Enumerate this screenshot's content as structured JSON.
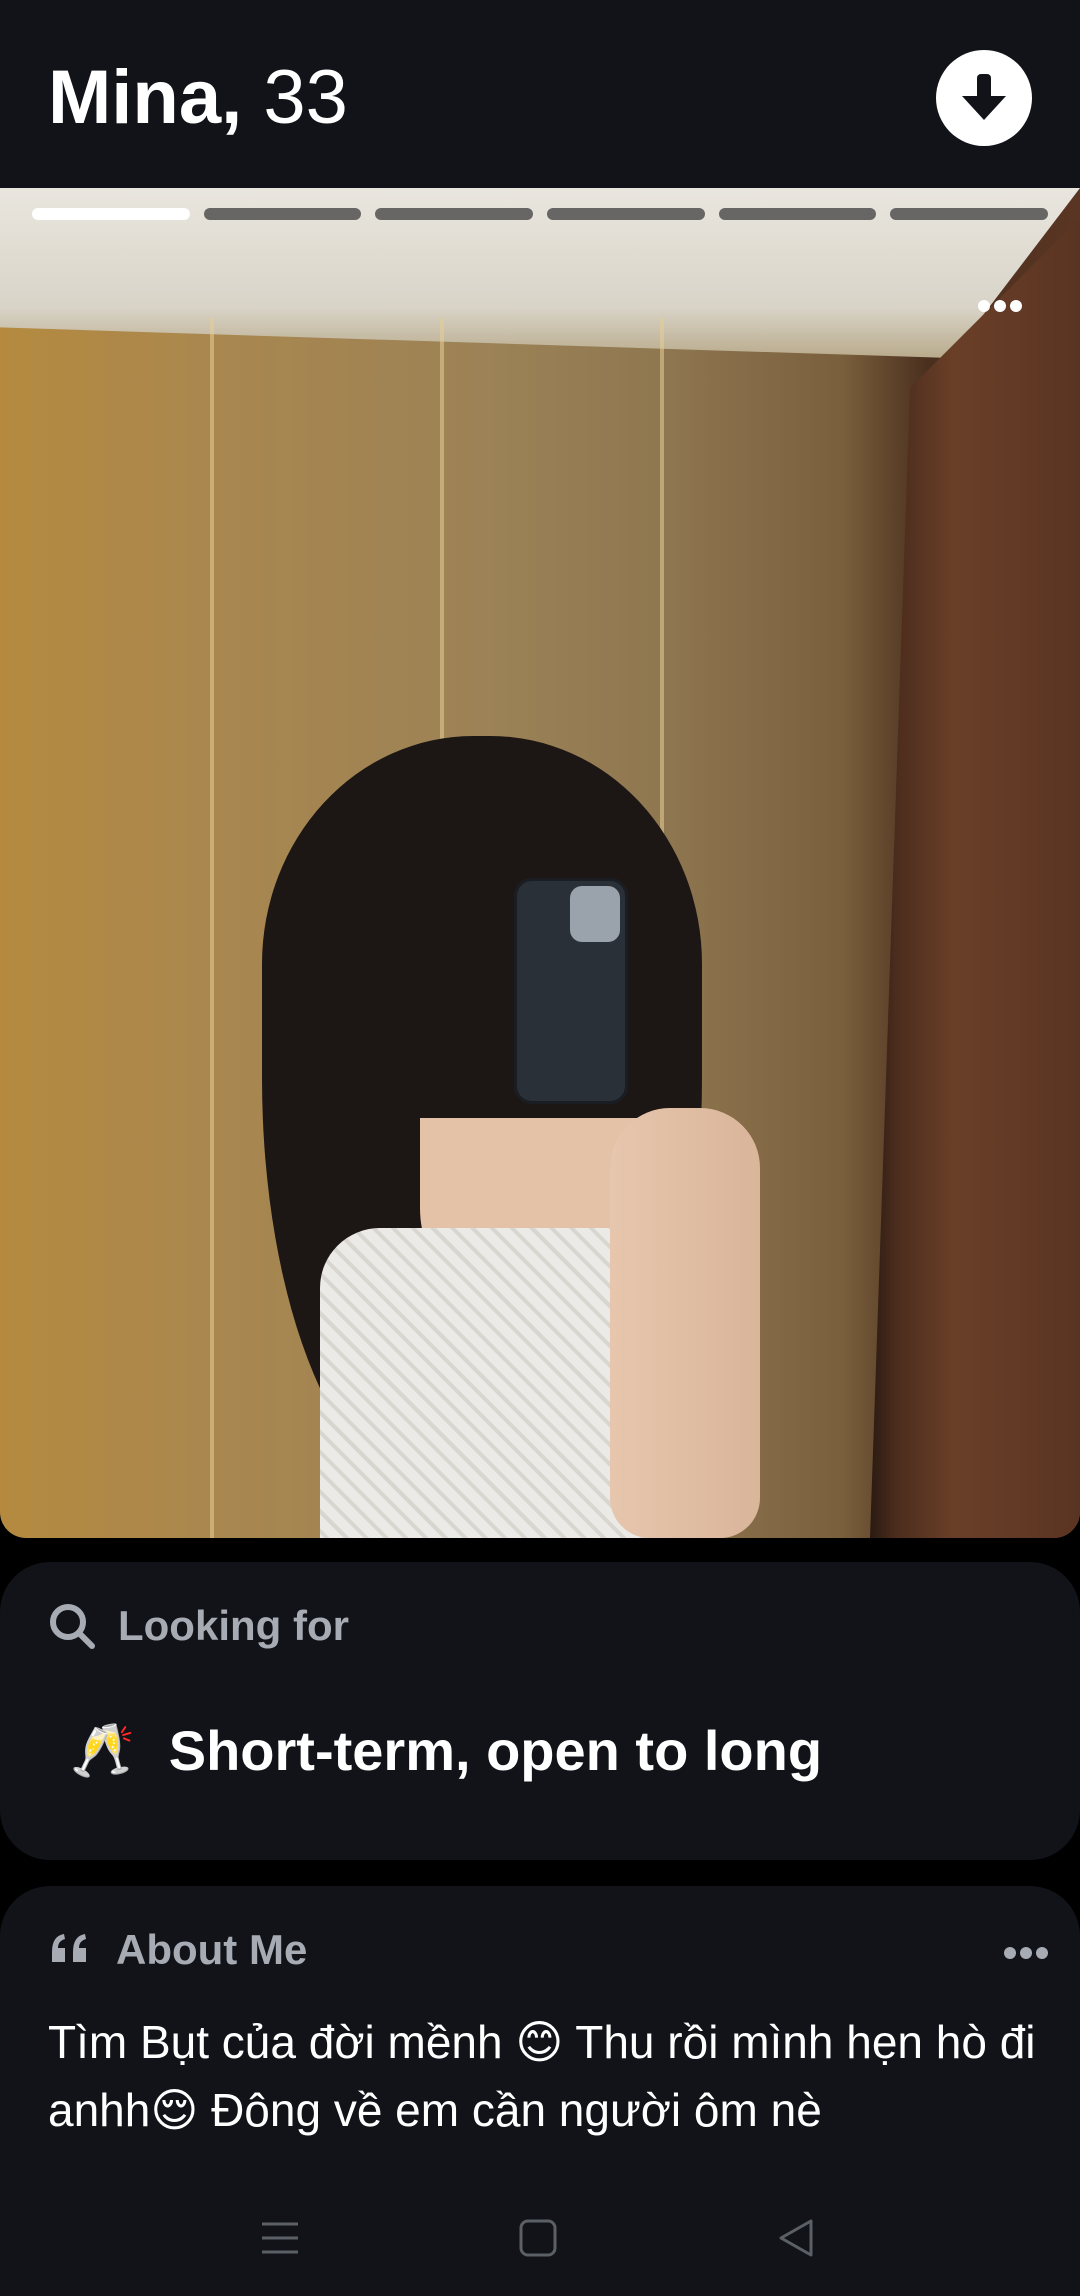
{
  "profile": {
    "name": "Mina,",
    "age": "33",
    "collapse_icon": "arrow-down-icon"
  },
  "photo": {
    "photo_count": 6,
    "active_index": 0,
    "more_icon": "more-horizontal-icon"
  },
  "looking_for": {
    "icon": "search-icon",
    "heading": "Looking for",
    "emoji": "🥂",
    "value": "Short-term, open to long"
  },
  "about": {
    "icon": "quote-icon",
    "heading": "About Me",
    "more_icon": "more-horizontal-icon",
    "text": "Tìm Bụt của đời mềnh 😊 Thu rồi mình hẹn hò đi anhh😌 Đông về em cần người ôm nè"
  },
  "navbar": {
    "menu_icon": "menu-icon",
    "home_icon": "square-icon",
    "back_icon": "back-triangle-icon"
  },
  "colors": {
    "background": "#000000",
    "card": "#111318",
    "muted_text": "#a7abb4",
    "text": "#ffffff"
  }
}
